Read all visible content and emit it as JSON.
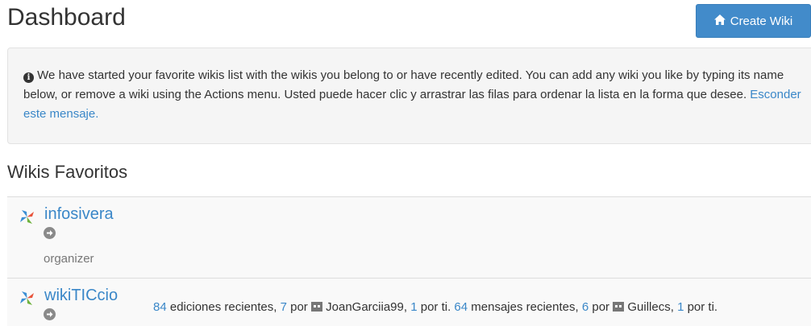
{
  "header": {
    "title": "Dashboard",
    "create_button_label": "Create Wiki"
  },
  "notice": {
    "text": " We have started your favorite wikis list with the wikis you belong to or have recently edited. You can add any wiki you like by typing its name below, or remove a wiki using the Actions menu. Usted puede hacer clic y arrastrar las filas para ordenar la lista en la forma que desee. ",
    "hide_link": "Esconder este mensaje."
  },
  "favorites": {
    "title": "Wikis Favoritos",
    "wikis": [
      {
        "name": "infosivera",
        "role": "organizer"
      },
      {
        "name": "wikiTICcio",
        "stats": {
          "recent_edits_count": "84",
          "recent_edits_label": " ediciones recientes, ",
          "by_you_edits_count": "7",
          "by_label_1": " por ",
          "user_1": "JoanGarciia99",
          "sep_1": ", ",
          "by_you_count_1": "1",
          "by_you_label_1": " por ti. ",
          "messages_count": "64",
          "messages_label": " mensajes recientes, ",
          "messages_by_count": "6",
          "by_label_2": " por ",
          "user_2": "Guillecs",
          "sep_2": ", ",
          "by_you_count_2": "1",
          "by_you_label_2": " por ti."
        }
      }
    ]
  },
  "colors": {
    "accent": "#428bca",
    "link": "#3a87c8",
    "notice_bg": "#f5f5f5"
  },
  "icons": {
    "create_button": "home-icon",
    "notice": "info-icon",
    "wiki_logo": "pinwheel-icon",
    "go": "arrow-circle-right-icon",
    "user": "user-avatar-icon"
  }
}
